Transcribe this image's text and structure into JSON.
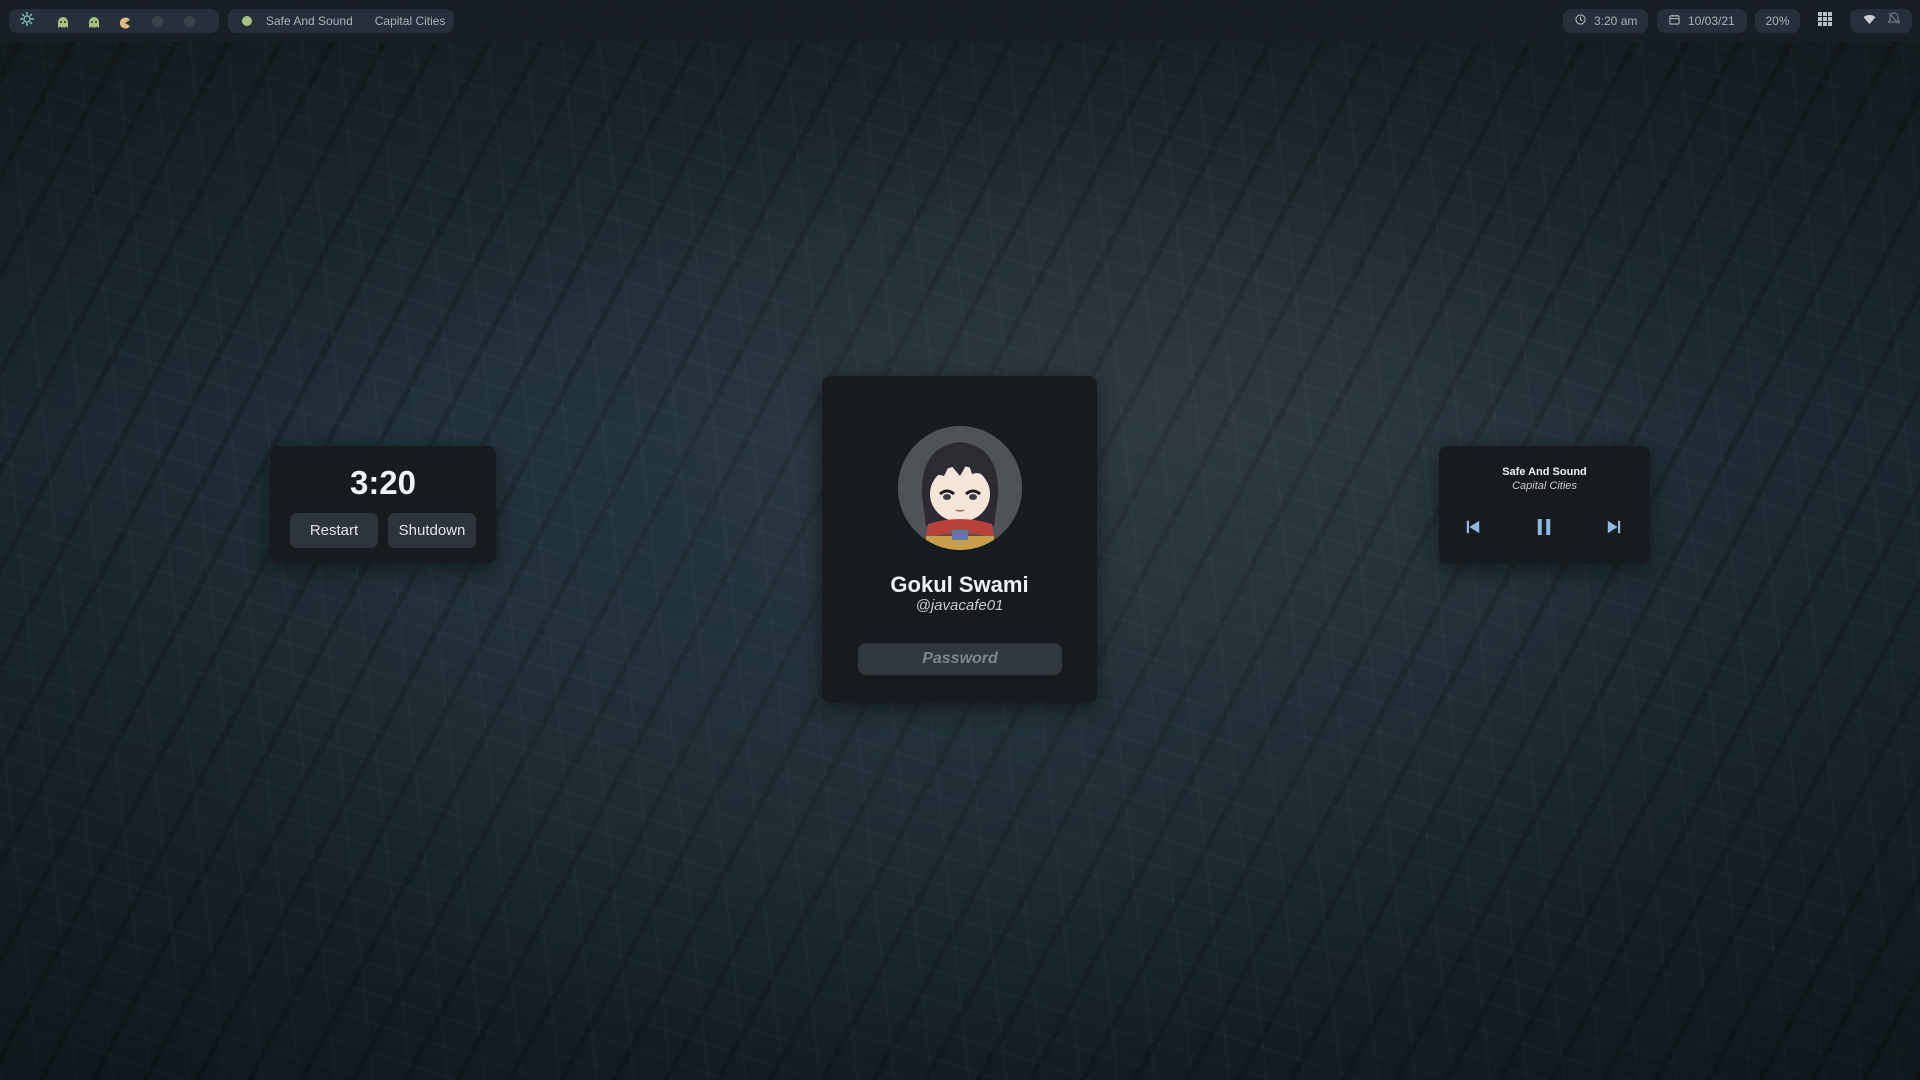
{
  "topbar": {
    "song_title": "Safe And Sound",
    "song_artist": "Capital Cities",
    "time": "3:20 am",
    "date": "10/03/21",
    "battery": "20%",
    "workspace_icons": [
      "ghost-icon",
      "ghost-icon",
      "pacman-icon",
      "dot-icon",
      "dot-icon"
    ]
  },
  "power": {
    "time": "3:20",
    "restart_label": "Restart",
    "shutdown_label": "Shutdown"
  },
  "login": {
    "name": "Gokul Swami",
    "handle": "@javacafe01",
    "password_placeholder": "Password"
  },
  "music": {
    "title": "Safe And Sound",
    "artist": "Capital Cities"
  },
  "colors": {
    "accent_green": "#a7c080",
    "accent_yellow": "#dbbc7f",
    "card_bg": "#161b20",
    "button_bg": "#2d343b"
  }
}
